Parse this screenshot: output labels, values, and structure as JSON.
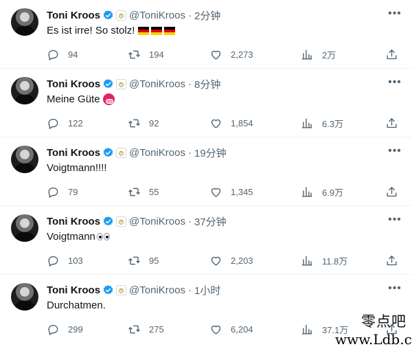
{
  "colors": {
    "text": "#0f1419",
    "muted": "#536471",
    "verified": "#1d9bf0",
    "divider": "#eff3f4"
  },
  "icons": {
    "reply": "speech-bubble-icon",
    "retweet": "retweet-arrows-icon",
    "like": "heart-icon",
    "views": "bar-chart-icon",
    "share": "share-upload-icon",
    "more": "ellipsis-icon",
    "verified": "verified-badge-icon",
    "club": "real-madrid-crest-icon"
  },
  "tweets": [
    {
      "name": "Toni Kroos",
      "handle": "@ToniKroos",
      "dot": "·",
      "time": "2分钟",
      "text": "Es ist irre! So stolz!",
      "emoji": "germany-flag x3",
      "replies": "94",
      "retweets": "194",
      "likes": "2,273",
      "views": "2万"
    },
    {
      "name": "Toni Kroos",
      "handle": "@ToniKroos",
      "dot": "·",
      "time": "8分钟",
      "text": "Meine Güte",
      "emoji": "flushed-face",
      "replies": "122",
      "retweets": "92",
      "likes": "1,854",
      "views": "6.3万"
    },
    {
      "name": "Toni Kroos",
      "handle": "@ToniKroos",
      "dot": "·",
      "time": "19分钟",
      "text": "Voigtmann!!!!",
      "emoji": "",
      "replies": "79",
      "retweets": "55",
      "likes": "1,345",
      "views": "6.9万"
    },
    {
      "name": "Toni Kroos",
      "handle": "@ToniKroos",
      "dot": "·",
      "time": "37分钟",
      "text": "Voigtmann",
      "emoji": "eyes",
      "replies": "103",
      "retweets": "95",
      "likes": "2,203",
      "views": "11.8万"
    },
    {
      "name": "Toni Kroos",
      "handle": "@ToniKroos",
      "dot": "·",
      "time": "1小时",
      "text": "Durchatmen.",
      "emoji": "",
      "replies": "299",
      "retweets": "275",
      "likes": "6,204",
      "views": "37.1万"
    }
  ],
  "watermark": {
    "top": "零点吧",
    "bottom": "www.Ldb.cc"
  }
}
